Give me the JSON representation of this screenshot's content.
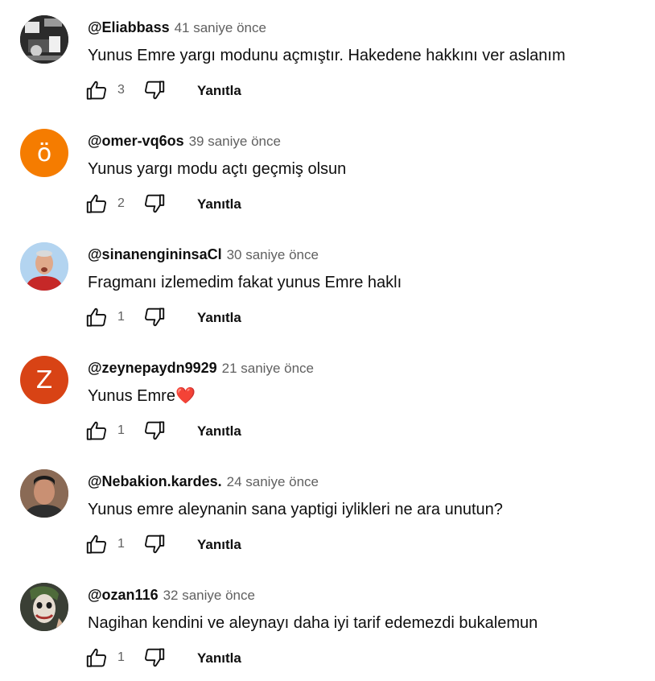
{
  "comments": [
    {
      "author": "@Eliabbass",
      "time": "41 saniye önce",
      "text": "Yunus Emre yargı modunu açmıştır. Hakedene hakkını ver aslanım",
      "likes": "3",
      "reply_label": "Yanıtla",
      "avatar": {
        "type": "image",
        "icon": "abstract-photo-avatar",
        "bg": "#2b2b2b"
      }
    },
    {
      "author": "@omer-vq6os",
      "time": "39 saniye önce",
      "text": "Yunus yargı modu açtı geçmiş olsun",
      "likes": "2",
      "reply_label": "Yanıtla",
      "avatar": {
        "type": "letter",
        "letter": "ö",
        "bg": "#f57c00"
      }
    },
    {
      "author": "@sinanengininsaCl",
      "time": "30 saniye önce",
      "text": "Fragmanı izlemedim fakat yunus Emre haklı",
      "likes": "1",
      "reply_label": "Yanıtla",
      "avatar": {
        "type": "image",
        "icon": "person-red-sweater-avatar",
        "bg": "#b3d4f0"
      }
    },
    {
      "author": "@zeynepaydn9929",
      "time": "21 saniye önce",
      "text": "Yunus Emre",
      "emoji": "❤️",
      "likes": "1",
      "reply_label": "Yanıtla",
      "avatar": {
        "type": "letter",
        "letter": "Z",
        "bg": "#d84315"
      }
    },
    {
      "author": "@Nebakion.kardes.",
      "time": "24 saniye önce",
      "text": "Yunus emre aleynanin sana yaptigi iylikleri ne ara unutun?",
      "likes": "1",
      "reply_label": "Yanıtla",
      "avatar": {
        "type": "image",
        "icon": "man-portrait-avatar",
        "bg": "#8a6a55"
      }
    },
    {
      "author": "@ozan116",
      "time": "32 saniye önce",
      "text": "Nagihan kendini ve aleynayı daha iyi tarif edemezdi bukalemun",
      "likes": "1",
      "reply_label": "Yanıtla",
      "avatar": {
        "type": "image",
        "icon": "joker-portrait-avatar",
        "bg": "#3a3f35"
      }
    }
  ]
}
